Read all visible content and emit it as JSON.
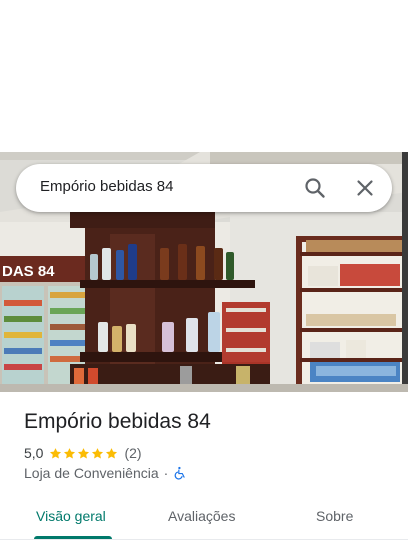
{
  "search": {
    "query": "Empório bebidas 84"
  },
  "photo": {
    "sign_text": "DAS 84"
  },
  "place": {
    "name": "Empório bebidas 84",
    "rating": "5,0",
    "stars": 5,
    "review_count": "(2)",
    "category": "Loja de Conveniência",
    "separator": "·"
  },
  "tabs": [
    {
      "label": "Visão geral",
      "active": true
    },
    {
      "label": "Avaliações",
      "active": false
    },
    {
      "label": "Sobre",
      "active": false
    }
  ],
  "colors": {
    "accent": "#00796b",
    "star": "#fbbc04",
    "accessibility": "#1a73e8"
  },
  "icons": {
    "search": "search-icon",
    "close": "close-icon",
    "accessibility": "wheelchair-icon"
  }
}
